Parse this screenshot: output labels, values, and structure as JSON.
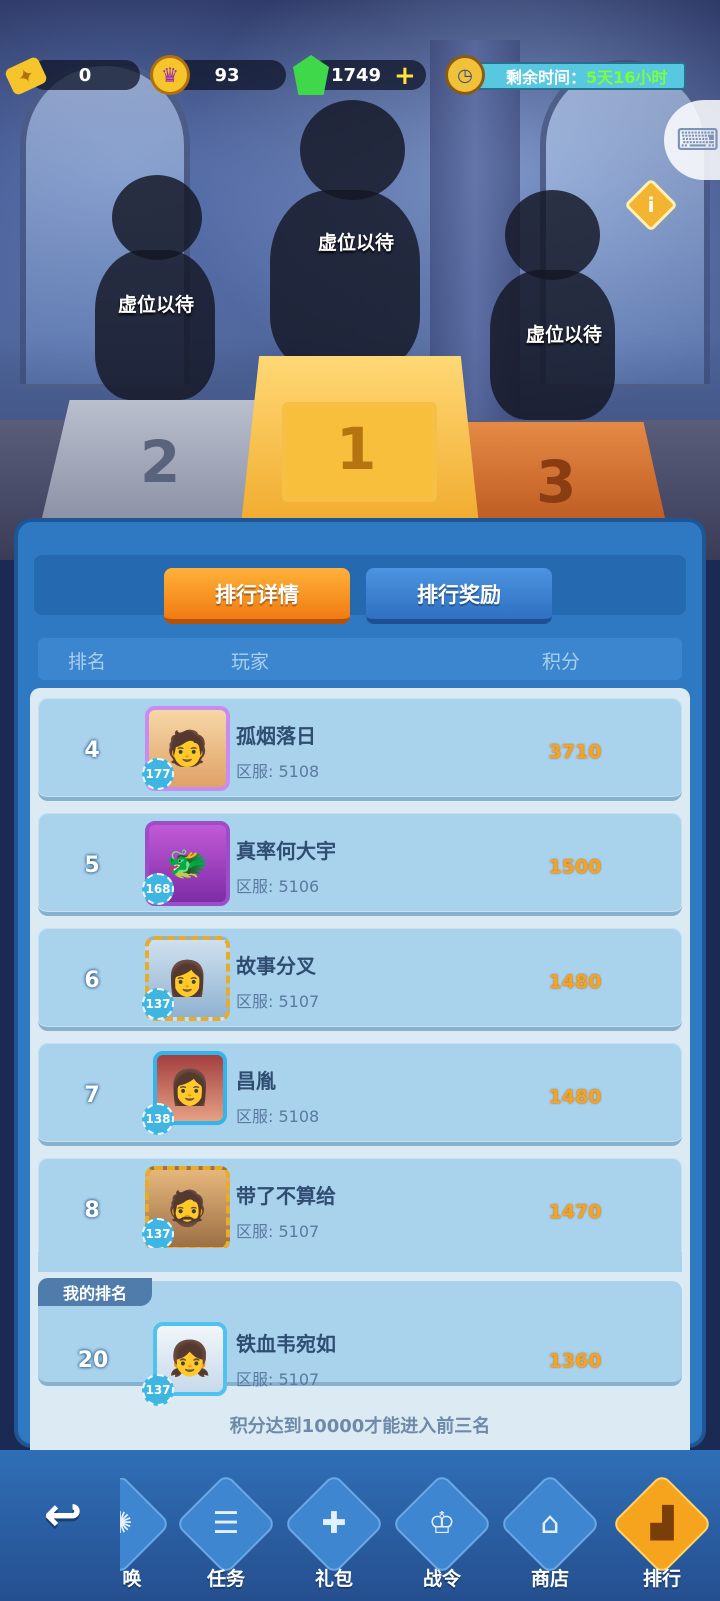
{
  "top_bar": {
    "tickets": "0",
    "trophies": "93",
    "gems": "1749",
    "timer_label": "剩余时间：",
    "timer_value": "5天16小时"
  },
  "podium": {
    "first": {
      "rank": "1",
      "placeholder": "虚位以待"
    },
    "second": {
      "rank": "2",
      "placeholder": "虚位以待"
    },
    "third": {
      "rank": "3",
      "placeholder": "虚位以待"
    }
  },
  "tabs": {
    "details": "排行详情",
    "rewards": "排行奖励"
  },
  "columns": {
    "rank": "排名",
    "player": "玩家",
    "score": "积分"
  },
  "rows": [
    {
      "rank": "4",
      "name": "孤烟落日",
      "server": "区服: 5108",
      "score": "3710",
      "level": "177"
    },
    {
      "rank": "5",
      "name": "真率何大宇",
      "server": "区服: 5106",
      "score": "1500",
      "level": "168"
    },
    {
      "rank": "6",
      "name": "故事分叉",
      "server": "区服: 5107",
      "score": "1480",
      "level": "137"
    },
    {
      "rank": "7",
      "name": "昌胤",
      "server": "区服: 5108",
      "score": "1480",
      "level": "138"
    },
    {
      "rank": "8",
      "name": "带了不算给",
      "server": "区服: 5107",
      "score": "1470",
      "level": "137"
    }
  ],
  "my_rank": {
    "label": "我的排名",
    "rank": "20",
    "name": "铁血韦宛如",
    "server": "区服: 5107",
    "score": "1360",
    "level": "137"
  },
  "hint": "积分达到10000才能进入前三名",
  "nav": {
    "summon": "唤",
    "tasks": "任务",
    "gifts": "礼包",
    "battle_pass": "战令",
    "shop": "商店",
    "ranking": "排行"
  },
  "icons": {
    "ticket": "ticket-icon",
    "trophy": "trophy-coin-icon",
    "gem": "green-gem-icon",
    "clock": "stopwatch-icon",
    "info": "info-icon",
    "back": "back-arrow-icon"
  }
}
